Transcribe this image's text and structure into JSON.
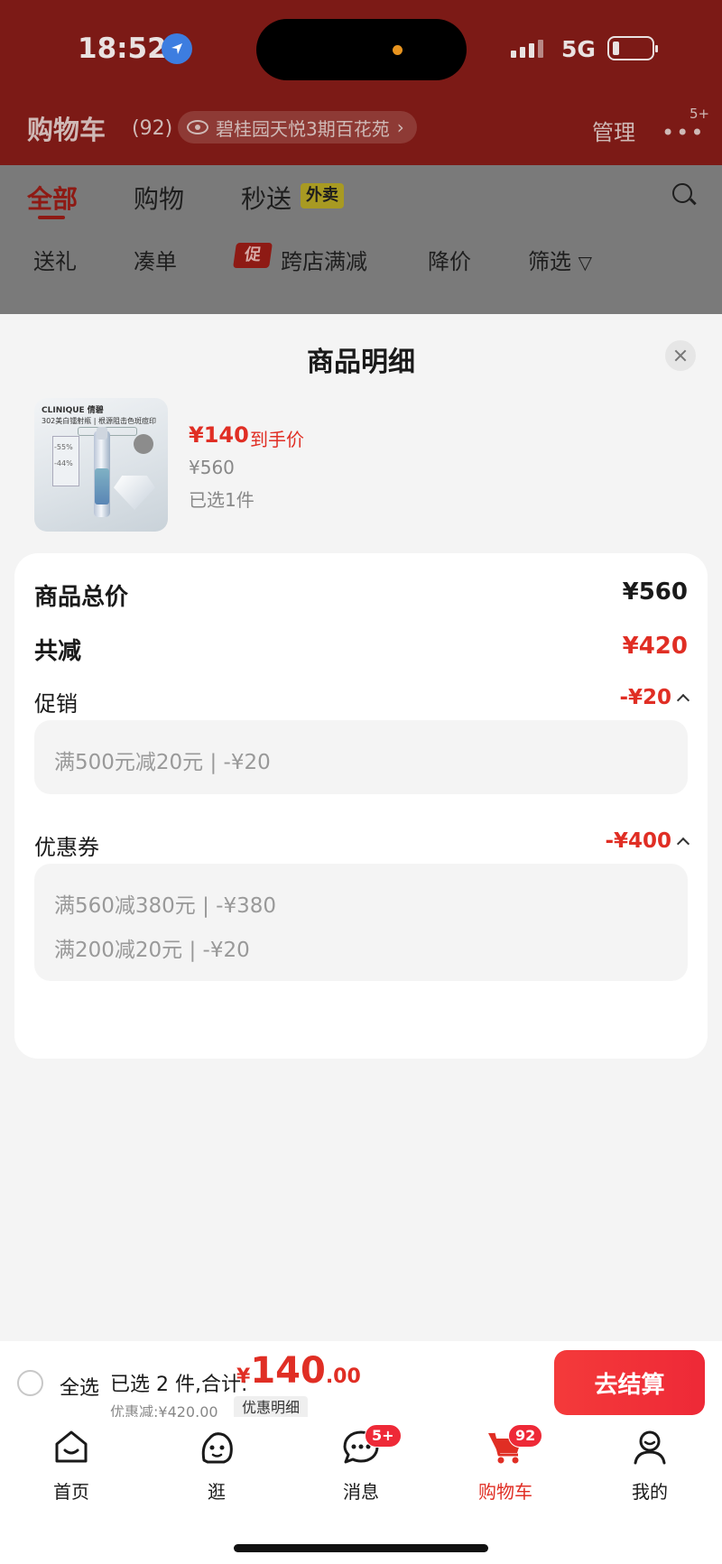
{
  "status_bar": {
    "time": "18:52",
    "network": "5G"
  },
  "header": {
    "title": "购物车",
    "count": "(92)",
    "address": "碧桂园天悦3期百花苑",
    "manage": "管理",
    "more_badge": "5+"
  },
  "tabs": [
    {
      "label": "全部"
    },
    {
      "label": "购物"
    },
    {
      "label": "秒送"
    }
  ],
  "takeout_tag": "外卖",
  "filters": {
    "gift": "送礼",
    "combine": "凑单",
    "promo_tag": "促",
    "cross_store": "跨店满减",
    "price_drop": "降价",
    "filter": "筛选"
  },
  "sheet": {
    "title": "商品明细",
    "product": {
      "image_brand": "CLINIQUE 倩碧",
      "image_line": "302美白镭射瓶 | 根源阻击色斑痘印",
      "image_pct1": "-55%",
      "image_pct2": "-44%",
      "final_price": "¥140",
      "final_price_label": "到手价",
      "original_price": "¥560",
      "selected_qty": "已选1件"
    },
    "total_label": "商品总价",
    "total_value": "¥560",
    "reduce_label": "共减",
    "reduce_value": "¥420",
    "promo_label": "促销",
    "promo_value": "-¥20",
    "promo_items": [
      "满500元减20元 | -¥20"
    ],
    "coupon_label": "优惠券",
    "coupon_value": "-¥400",
    "coupon_items": [
      "满560减380元 | -¥380",
      "满200减20元 | -¥20"
    ]
  },
  "checkout": {
    "select_all": "全选",
    "summary_label": "已选 2 件,合计:",
    "currency": "¥",
    "total_int": "140",
    "total_dec": ".00",
    "discount_label": "优惠减:¥420.00",
    "detail_button": "优惠明细",
    "checkout_button": "去结算"
  },
  "tabbar": [
    {
      "label": "首页"
    },
    {
      "label": "逛"
    },
    {
      "label": "消息",
      "badge": "5+"
    },
    {
      "label": "购物车",
      "badge": "92"
    },
    {
      "label": "我的"
    }
  ],
  "colors": {
    "accent": "#e02e24",
    "header_dim": "#7c1a16"
  }
}
